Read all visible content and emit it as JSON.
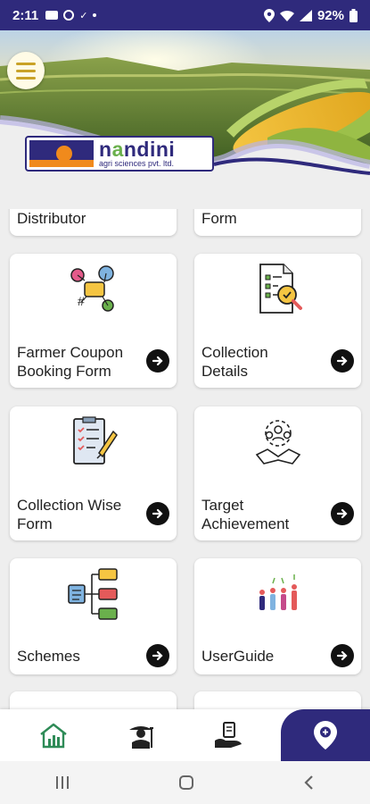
{
  "status_bar": {
    "time": "2:11",
    "battery": "92%"
  },
  "header": {
    "logo": {
      "name_first": "n",
      "name_accent": "a",
      "name_rest": "ndini",
      "subtitle": "agri sciences pvt. ltd."
    }
  },
  "cards": [
    {
      "label": "Distributor"
    },
    {
      "label": "Form"
    },
    {
      "label_line1": "Farmer Coupon",
      "label_line2": "Booking Form"
    },
    {
      "label_line1": "Collection",
      "label_line2": "Details"
    },
    {
      "label_line1": "Collection Wise",
      "label_line2": "Form"
    },
    {
      "label_line1": "Target",
      "label_line2": "Achievement"
    },
    {
      "label": "Schemes"
    },
    {
      "label": "UserGuide"
    }
  ],
  "bottom_nav": {
    "items": [
      {
        "icon": "home-chart-icon"
      },
      {
        "icon": "farmer-icon"
      },
      {
        "icon": "hand-document-icon"
      },
      {
        "icon": "location-pin-icon"
      }
    ]
  },
  "colors": {
    "brand": "#2f2a7c",
    "accent_orange": "#f08a1c",
    "accent_green": "#6ab04c"
  }
}
